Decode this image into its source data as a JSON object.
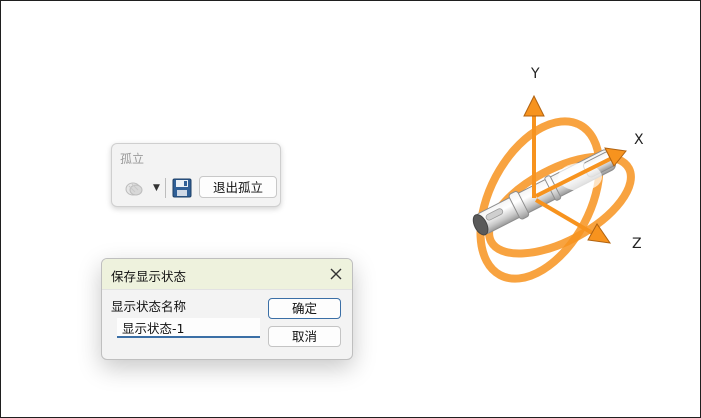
{
  "isolate_panel": {
    "title": "孤立",
    "exit_label": "退出孤立",
    "icons": [
      "display-style-icon",
      "chevron-down-icon",
      "save-icon"
    ]
  },
  "dialog": {
    "title": "保存显示状态",
    "field_label": "显示状态名称",
    "field_value": "显示状态-1",
    "ok_label": "确定",
    "cancel_label": "取消"
  },
  "triad": {
    "x_label": "X",
    "y_label": "Y",
    "z_label": "Z",
    "color": "#f7931e"
  },
  "colors": {
    "accent": "#3b6fa6",
    "dialog_header": "#eef2dd",
    "panel_bg": "#f3f3f3"
  }
}
